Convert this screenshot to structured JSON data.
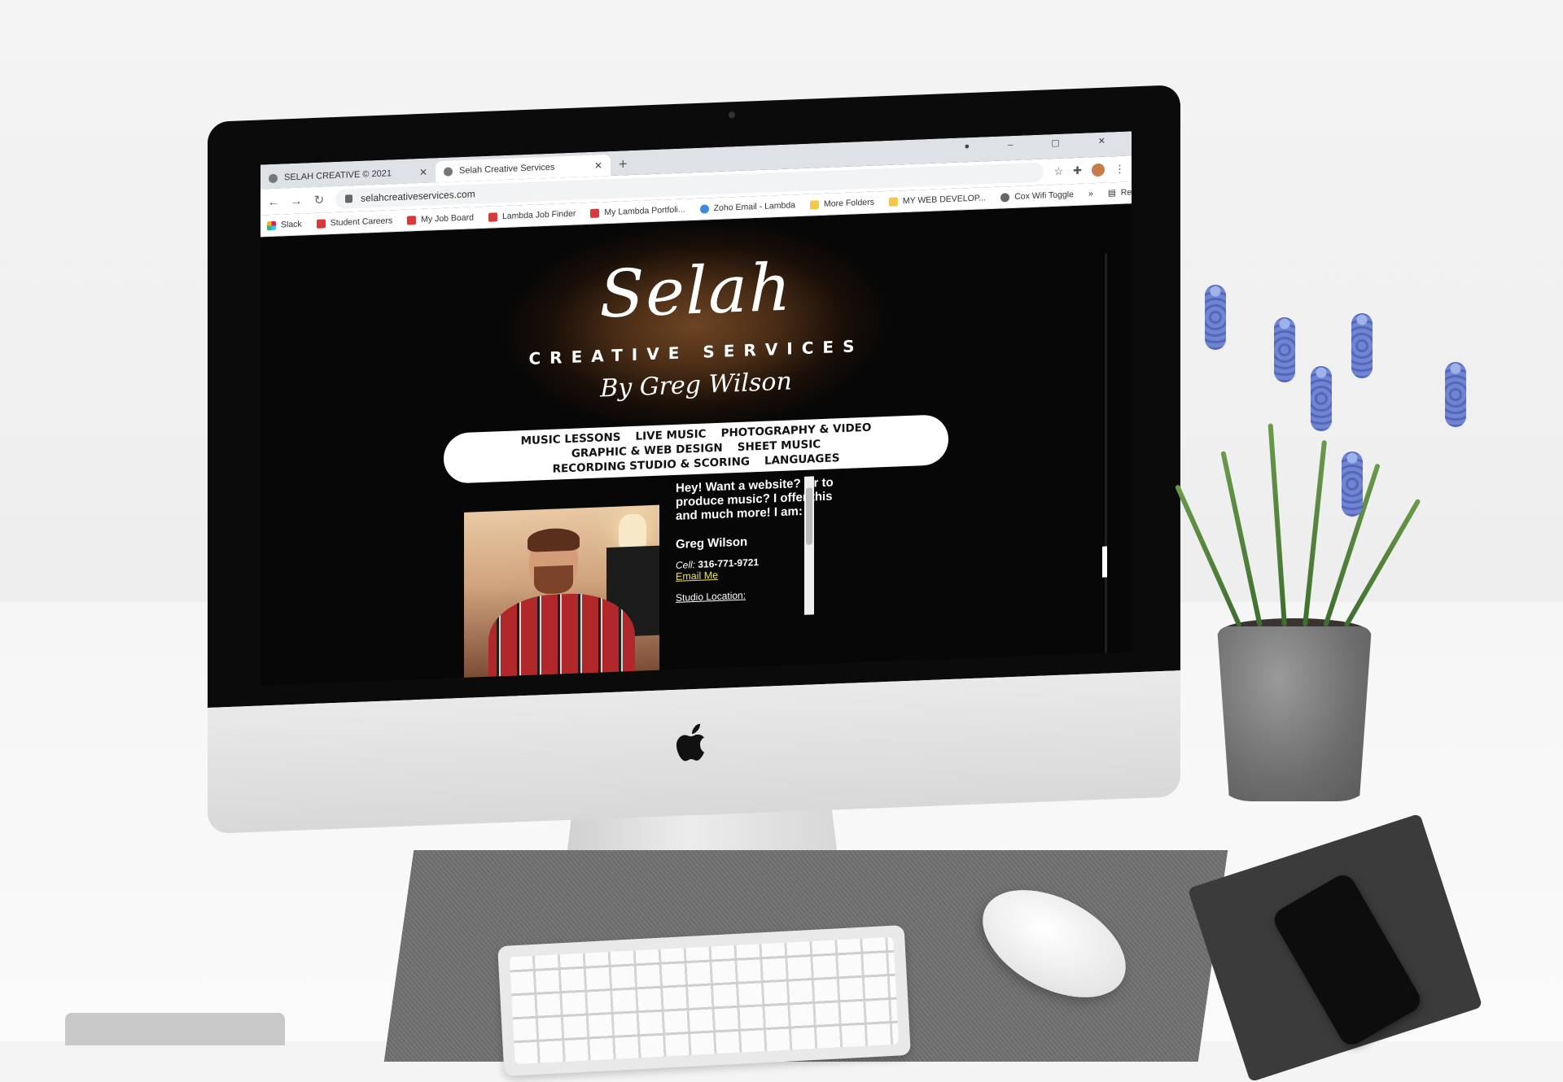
{
  "browser": {
    "tabs": [
      {
        "title": "SELAH CREATIVE © 2021",
        "active": false
      },
      {
        "title": "Selah Creative Services",
        "active": true
      }
    ],
    "new_tab_symbol": "+",
    "url": "selahcreativeservices.com",
    "reading_list": "Reading list",
    "bookmarks": [
      {
        "label": "Slack",
        "icon": "slack-icon"
      },
      {
        "label": "Student Careers",
        "icon": "lambda-icon"
      },
      {
        "label": "My Job Board",
        "icon": "lambda-icon"
      },
      {
        "label": "Lambda Job Finder",
        "icon": "lambda-icon"
      },
      {
        "label": "My Lambda Portfoli...",
        "icon": "lambda-icon"
      },
      {
        "label": "Zoho Email - Lambda",
        "icon": "zoho-icon"
      },
      {
        "label": "More Folders",
        "icon": "folder-icon"
      },
      {
        "label": "MY WEB DEVELOP...",
        "icon": "folder-icon"
      },
      {
        "label": "Cox Wifi Toggle",
        "icon": "globe-icon"
      }
    ],
    "overflow_symbol": "»"
  },
  "site": {
    "logo_script": "Selah",
    "logo_sub": "CREATIVE SERVICES",
    "logo_by": "By Greg Wilson",
    "nav": [
      "Music Lessons",
      "Live Music",
      "Photography & Video",
      "Graphic & Web Design",
      "Sheet Music",
      "Recording Studio & Scoring",
      "Languages"
    ],
    "bio": {
      "intro": "Hey! Want a website? Or to produce music? I offer this and much more! I am:",
      "name": "Greg Wilson",
      "cell_label": "Cell:",
      "cell_number": "316-771-9721",
      "email_link": "Email Me",
      "studio_label": "Studio Location:"
    }
  },
  "colors": {
    "page_bg": "#050505",
    "link_yellow": "#f0e24d",
    "wood_brown": "#6d4423",
    "flower_blue": "#5a6fc6"
  }
}
